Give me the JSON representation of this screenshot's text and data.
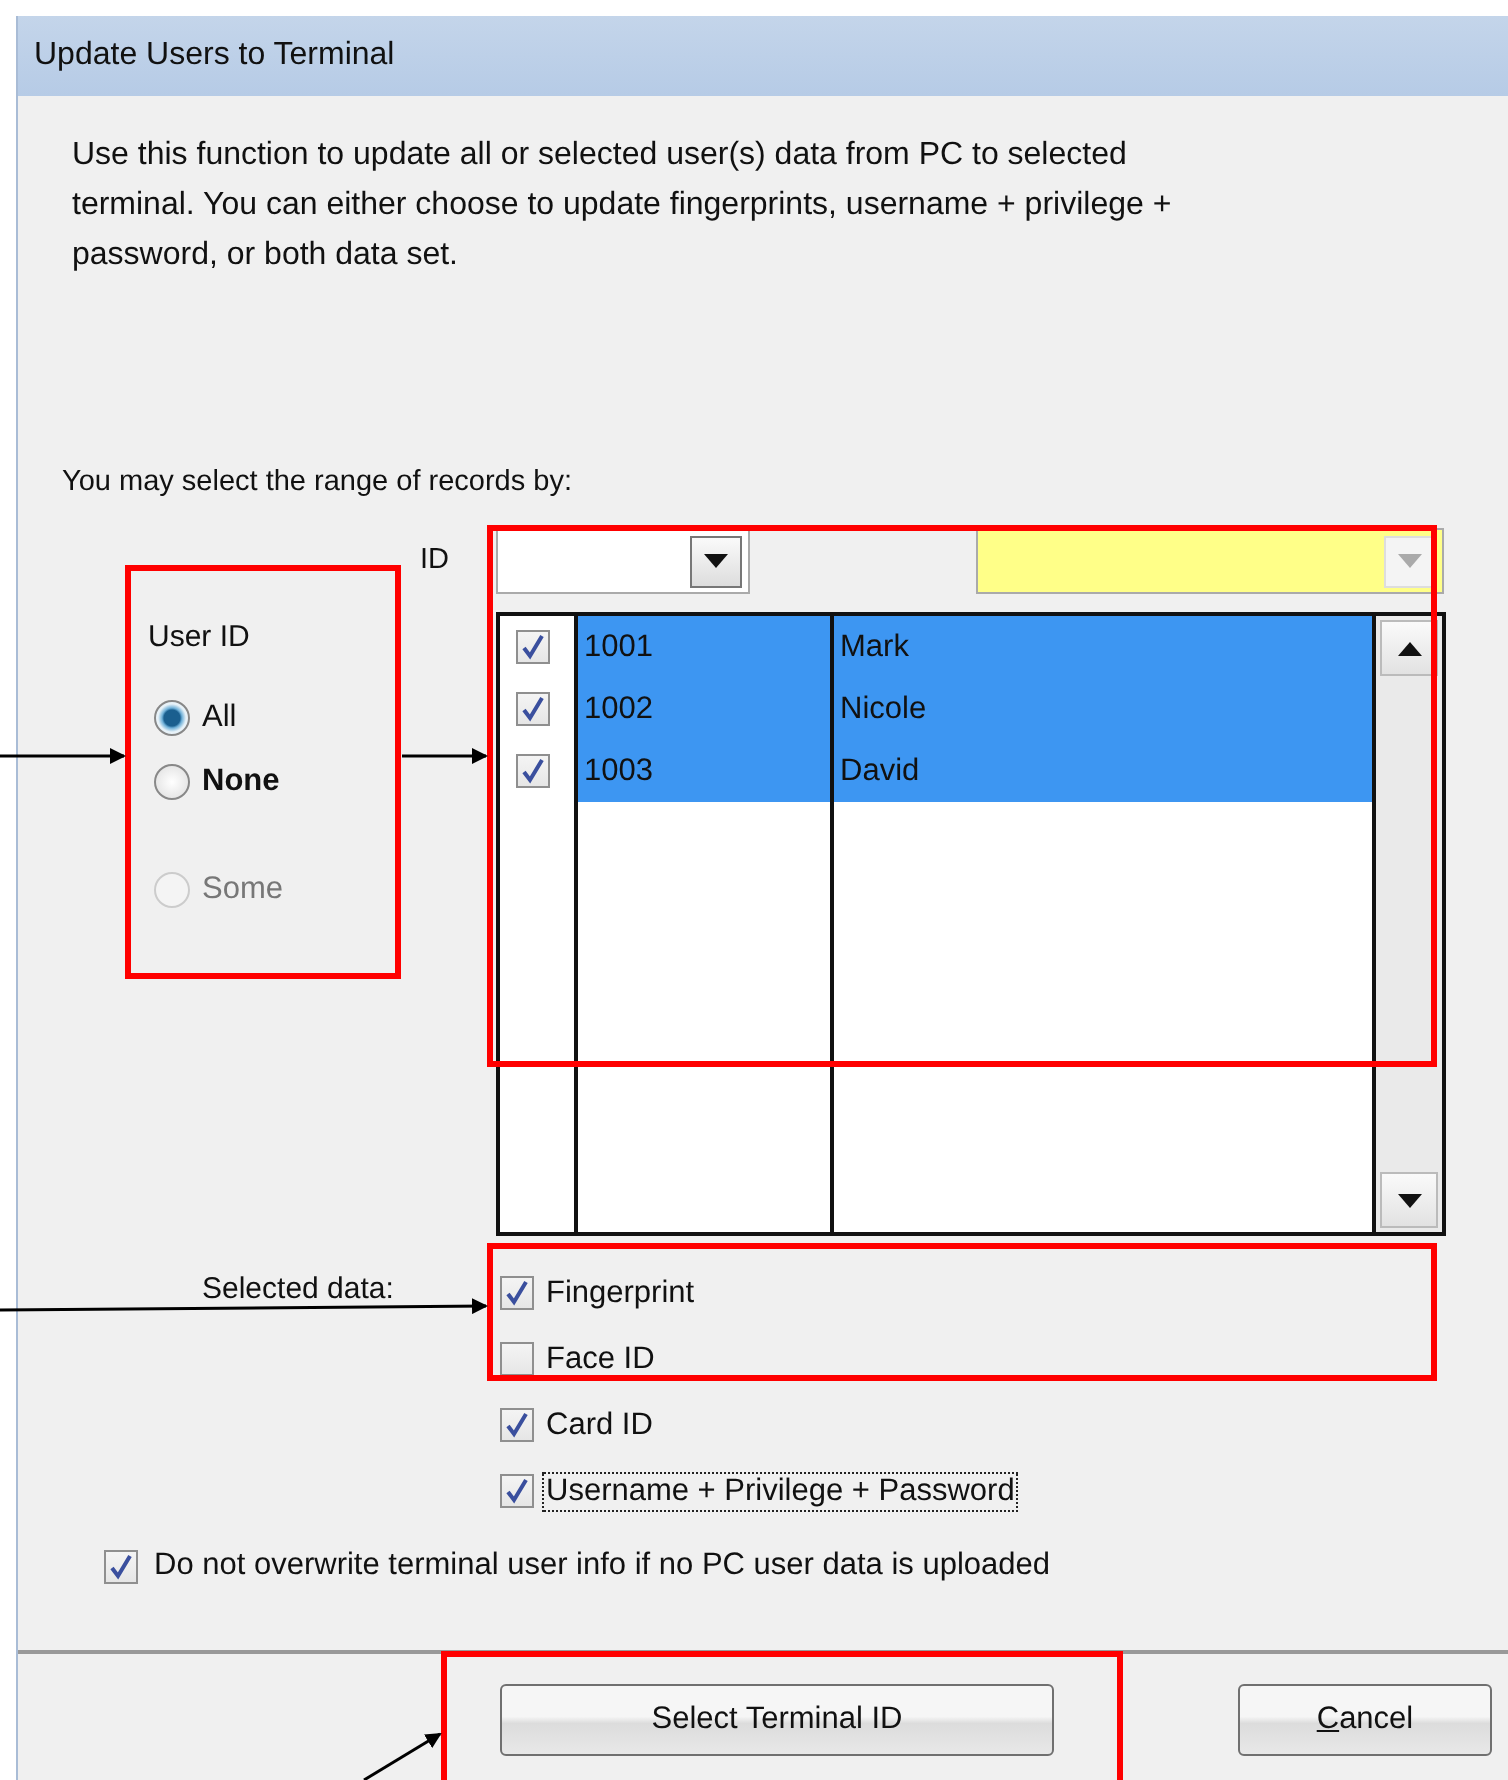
{
  "window": {
    "title": "Update Users to Terminal"
  },
  "description": "Use this function to update all or selected user(s) data from PC to selected terminal. You can either choose to update fingerprints, username + privilege + password, or both data set.",
  "range_label": "You may select the range of records by:",
  "filter": {
    "label": "ID"
  },
  "user_id_group": {
    "label": "User ID",
    "options": [
      {
        "label": "All",
        "selected": true,
        "bold": false,
        "disabled": false
      },
      {
        "label": "None",
        "selected": false,
        "bold": true,
        "disabled": false
      },
      {
        "label": "Some",
        "selected": false,
        "bold": false,
        "disabled": true
      }
    ]
  },
  "records": [
    {
      "checked": true,
      "id": "1001",
      "name": "Mark",
      "selected": true
    },
    {
      "checked": true,
      "id": "1002",
      "name": "Nicole",
      "selected": true
    },
    {
      "checked": true,
      "id": "1003",
      "name": "David",
      "selected": true
    }
  ],
  "selected_data": {
    "label": "Selected data:",
    "options": [
      {
        "label": "Fingerprint",
        "checked": true,
        "focused": false
      },
      {
        "label": "Face ID",
        "checked": false,
        "focused": false
      },
      {
        "label": "Card ID",
        "checked": true,
        "focused": false
      },
      {
        "label": "Username + Privilege + Password",
        "checked": true,
        "focused": true
      }
    ]
  },
  "overwrite_option": {
    "label": "Do not overwrite terminal user info if no PC user data is uploaded",
    "checked": true
  },
  "buttons": [
    {
      "label": "Select Terminal ID",
      "kind": "primary"
    },
    {
      "label": "Cancel",
      "kind": "cancel"
    }
  ]
}
